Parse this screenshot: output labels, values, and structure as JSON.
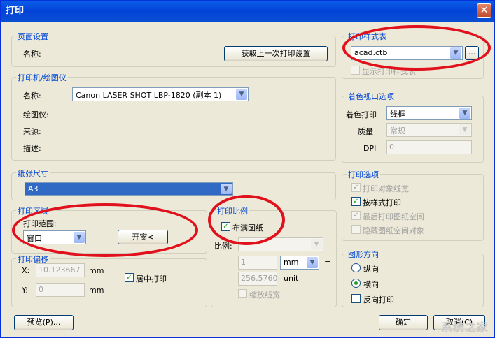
{
  "window": {
    "title": "打印",
    "close_label": "✕"
  },
  "page_setup": {
    "group_label": "页面设置",
    "name_label": "名称:",
    "load_button": "获取上一次打印设置"
  },
  "printer": {
    "group_label": "打印机/绘图仪",
    "name_label": "名称:",
    "name_value": "Canon LASER SHOT LBP-1820 (副本 1)",
    "plotter_label": "绘图仪:",
    "location_label": "来源:",
    "desc_label": "描述:"
  },
  "paper": {
    "group_label": "纸张尺寸",
    "value": "A3"
  },
  "plot_area": {
    "group_label": "打印区域",
    "range_label": "打印范围:",
    "range_value": "窗口",
    "window_button": "开窗<"
  },
  "plot_offset": {
    "group_label": "打印偏移",
    "x_label": "X:",
    "x_value": "10.123667",
    "y_label": "Y:",
    "y_value": "0",
    "unit_x": "mm",
    "unit_y": "mm",
    "center_label": "居中打印"
  },
  "plot_scale": {
    "group_label": "打印比例",
    "fit_label": "布满图纸",
    "scale_label": "比例:",
    "value1": "1",
    "unit1": "mm",
    "equals": "=",
    "value2": "256.5760",
    "unit2": "unit",
    "lineweights_label": "缩放线宽"
  },
  "plot_style": {
    "group_label": "打印样式表",
    "value": "acad.ctb",
    "browse_label": "...",
    "display_label": "显示打印样式表"
  },
  "shaded": {
    "group_label": "着色视口选项",
    "shade_label": "着色打印",
    "shade_value": "线框",
    "quality_label": "质量",
    "quality_value": "常规",
    "dpi_label": "DPI",
    "dpi_value": "0"
  },
  "plot_options": {
    "group_label": "打印选项",
    "items": [
      {
        "label": "打印对象线宽"
      },
      {
        "label": "按样式打印"
      },
      {
        "label": "最后打印图纸空间"
      },
      {
        "label": "隐藏图纸空间对象"
      }
    ]
  },
  "orientation": {
    "group_label": "图形方向",
    "portrait": "纵向",
    "landscape": "横向",
    "reverse": "反向打印"
  },
  "footer": {
    "preview_button": "预览(P)...",
    "ok_button": "确定",
    "cancel_button": "取消(C)",
    "watermark": "系统之家"
  },
  "colors": {
    "accent": "#0046d5",
    "annotation": "#e0101c",
    "dialog_bg": "#ece9d8"
  }
}
